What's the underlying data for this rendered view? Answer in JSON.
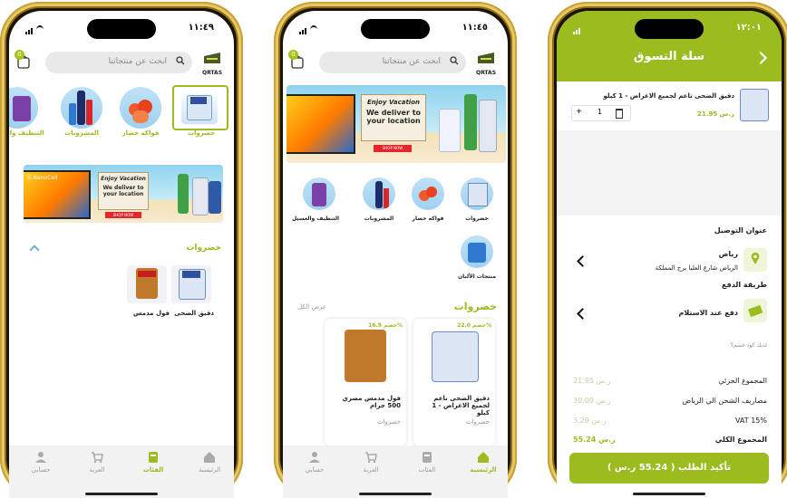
{
  "colors": {
    "accent": "#9bbb1f",
    "frame": "#c9a23a"
  },
  "phone1": {
    "time": "١١:٤٩",
    "search_placeholder": "ابحث عن منتجاتنا",
    "cart_count": "0",
    "logo": "QRTAS",
    "categories": [
      {
        "label": "خضروات",
        "icon": "rice-bag-icon"
      },
      {
        "label": "فواكه خضار",
        "icon": "tomatoes-icon"
      },
      {
        "label": "المشروبات",
        "icon": "drinks-icon"
      },
      {
        "label": "التنظيف والغ",
        "icon": "detergent-icon"
      }
    ],
    "banner": {
      "line1": "Enjoy Vacation",
      "line2": "We deliver to",
      "line3": "your location",
      "cta": "SHOP NOW",
      "tv_text": "G NanoCell"
    },
    "section_title": "خضروات",
    "products": [
      {
        "name": "دقيق الضحى"
      },
      {
        "name": "فول مدمس"
      }
    ],
    "nav": [
      {
        "label": "الرئيسية",
        "icon": "home-icon"
      },
      {
        "label": "الفئات",
        "icon": "categories-icon"
      },
      {
        "label": "العربة",
        "icon": "cart-icon"
      },
      {
        "label": "حسابي",
        "icon": "account-icon"
      }
    ]
  },
  "phone2": {
    "time": "١١:٤٥",
    "search_placeholder": "ابحث عن منتجاتنا",
    "cart_count": "0",
    "logo": "QRTAS",
    "banner": {
      "line1": "Enjoy Vacation",
      "line2": "We deliver to",
      "line3": "your location",
      "cta": "SHOP NOW"
    },
    "categories": [
      {
        "label": "خضروات"
      },
      {
        "label": "فواكه خضار"
      },
      {
        "label": "المشروبات"
      },
      {
        "label": "التنظيف والغسيل"
      },
      {
        "label": "منتجات الألبان"
      }
    ],
    "section_title": "خضروات",
    "see_all": "عرض الكل",
    "products": [
      {
        "discount": "خصم 22.0%",
        "name": "دقيق الضحى ناعم لجميع الاغراض - 1 كيلو",
        "category": "خضروات"
      },
      {
        "discount": "خصم 16.9%",
        "name": "فول مدمس مصري 500 جرام",
        "category": "خضروات"
      }
    ],
    "nav": [
      {
        "label": "الرئيسية"
      },
      {
        "label": "الفئات"
      },
      {
        "label": "العربة"
      },
      {
        "label": "حسابي"
      }
    ]
  },
  "phone3": {
    "time": "١٢:٠١",
    "title": "سلة التسوق",
    "item": {
      "name": "دقيق الضحى ناعم لجميع الاغراض - 1 كيلو",
      "price": "21.95 ر.س",
      "qty": "1"
    },
    "delivery_title": "عنوان التوصيل",
    "address_city": "رياض",
    "address_line": "الرياض شارع العليا برج المملكة",
    "payment_title": "طريقة الدفع",
    "payment_method": "دفع عند الاستلام",
    "coupon_prompt": "لديك كود خصم؟",
    "summary": [
      {
        "label": "المجموع الجزئي",
        "value": "21.95 ر.س"
      },
      {
        "label": "مصاريف الشحن الي الرياض",
        "value": "30.00 ر.س"
      },
      {
        "label": "VAT 15%",
        "value": "3.29 ر.س"
      },
      {
        "label": "المجموع الكلي",
        "value": "55.24 ر.س"
      }
    ],
    "confirm": "تأكيد الطلب ( 55.24 ر.س )"
  }
}
